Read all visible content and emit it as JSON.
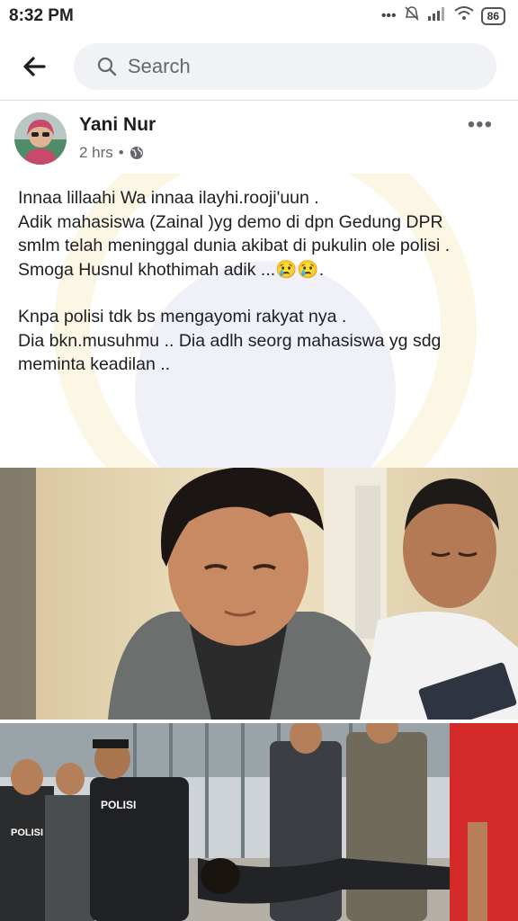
{
  "status_bar": {
    "time": "8:32 PM",
    "battery": "86"
  },
  "nav": {
    "search_placeholder": "Search"
  },
  "post": {
    "author": "Yani Nur",
    "time": "2 hrs",
    "separator": "•",
    "more": "•••",
    "lines": [
      "Innaa lillaahi Wa innaa ilayhi.rooji'uun .",
      "Adik mahasiswa  (Zainal )yg demo di dpn Gedung DPR",
      "smlm telah meninggal dunia  akibat di pukulin ole polisi .",
      "Smoga Husnul khothimah adik ...😢😢."
    ],
    "lines2": [
      "Knpa polisi tdk bs mengayomi rakyat nya .",
      "Dia bkn.musuhmu .. Dia adlh seorg mahasiswa yg sdg meminta keadilan .."
    ]
  },
  "photos": {
    "vest_label": "POLISI",
    "vest_label_2": "POLISI"
  }
}
